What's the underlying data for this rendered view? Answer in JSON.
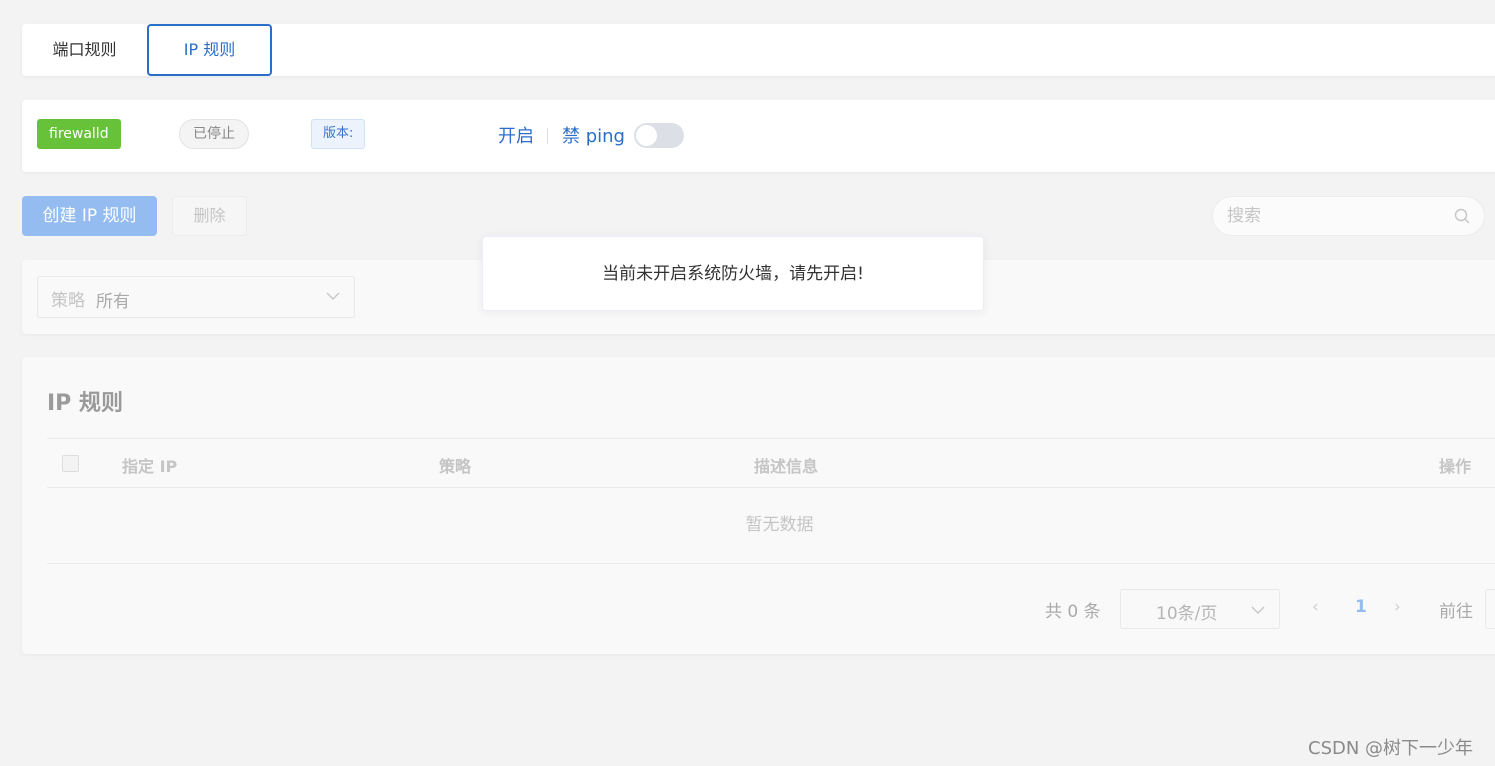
{
  "tabs": [
    {
      "label": "端口规则",
      "active": false
    },
    {
      "label": "IP 规则",
      "active": true
    }
  ],
  "status": {
    "service": "firewalld",
    "state": "已停止",
    "version_label": "版本:",
    "open_link": "开启",
    "ping_label": "禁 ping",
    "ping_enabled": false
  },
  "toolbar": {
    "create_label": "创建 IP 规则",
    "delete_label": "删除",
    "search_placeholder": "搜索"
  },
  "filter": {
    "policy_label": "策略",
    "policy_value": "所有"
  },
  "toast": {
    "message": "当前未开启系统防火墙，请先开启!"
  },
  "table": {
    "title": "IP 规则",
    "columns": [
      "指定 IP",
      "策略",
      "描述信息",
      "操作"
    ],
    "rows": [],
    "empty_text": "暂无数据"
  },
  "pagination": {
    "total_text": "共 0 条",
    "page_size": "10条/页",
    "prev": "‹",
    "current_page": "1",
    "next": "›",
    "goto_label": "前往"
  },
  "watermark": "CSDN @树下一少年",
  "colors": {
    "primary": "#2b6ec9",
    "success": "#67c23a",
    "primary_disabled": "#94bcf1"
  }
}
